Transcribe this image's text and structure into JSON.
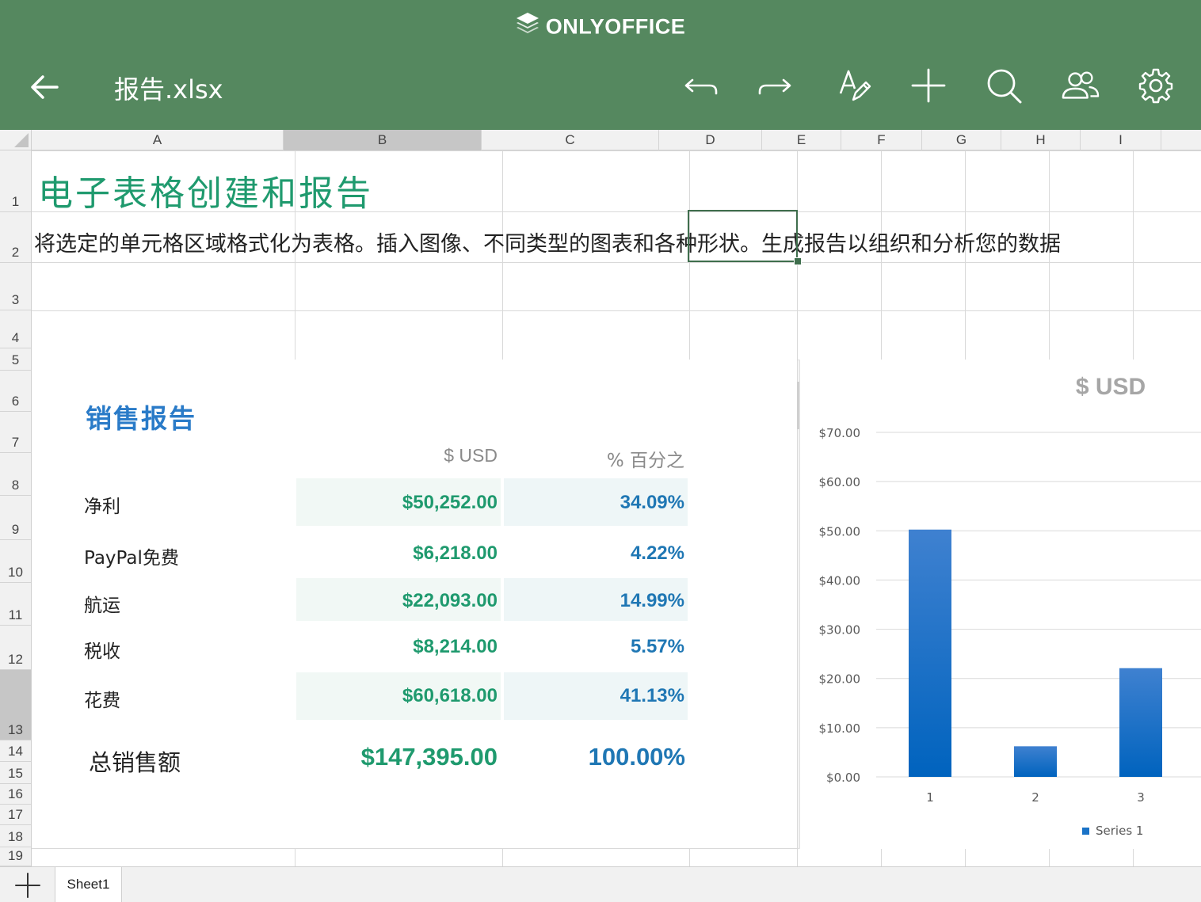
{
  "app": {
    "brand": "ONLYOFFICE",
    "document_title": "报告.xlsx",
    "toolbar": [
      "undo-icon",
      "redo-icon",
      "text-format-icon",
      "add-icon",
      "search-icon",
      "collaborators-icon",
      "settings-icon"
    ],
    "theme_color": "#55885f"
  },
  "grid": {
    "columns": [
      "A",
      "B",
      "C",
      "D",
      "E",
      "F",
      "G",
      "H",
      "I"
    ],
    "rows": [
      "1",
      "2",
      "3",
      "4",
      "5",
      "6",
      "7",
      "8",
      "9",
      "10",
      "11",
      "12",
      "13",
      "14",
      "15",
      "16",
      "17",
      "18",
      "19"
    ],
    "selected_cell": "D2"
  },
  "sheet": {
    "title": "电子表格创建和报告",
    "description": "将选定的单元格区域格式化为表格。插入图像、不同类型的图表和各种形状。生成报告以组织和分析您的数据"
  },
  "report": {
    "title": "销售报告",
    "col_usd": "$ USD",
    "col_pct": "% 百分之",
    "items": [
      {
        "label": "净利",
        "usd": "$50,252.00",
        "pct": "34.09%"
      },
      {
        "label": "PayPal免费",
        "usd": "$6,218.00",
        "pct": "4.22%"
      },
      {
        "label": "航运",
        "usd": "$22,093.00",
        "pct": "14.99%"
      },
      {
        "label": "税收",
        "usd": "$8,214.00",
        "pct": "5.57%"
      },
      {
        "label": "花费",
        "usd": "$60,618.00",
        "pct": "41.13%"
      }
    ],
    "total_label": "总销售额",
    "total_usd": "$147,395.00",
    "total_pct": "100.00%"
  },
  "chart_data": {
    "type": "bar",
    "title": "$ USD",
    "categories": [
      "1",
      "2",
      "3"
    ],
    "series": [
      {
        "name": "Series 1",
        "values": [
          50.25,
          6.22,
          22.09
        ]
      }
    ],
    "ylim": [
      0,
      70
    ],
    "yticks": [
      "$0.00",
      "$10.00",
      "$20.00",
      "$30.00",
      "$40.00",
      "$50.00",
      "$60.00",
      "$70.00"
    ],
    "grid": true,
    "legend": "bottom",
    "color": "#1a73c7"
  },
  "tabs": {
    "sheets": [
      "Sheet1"
    ]
  }
}
